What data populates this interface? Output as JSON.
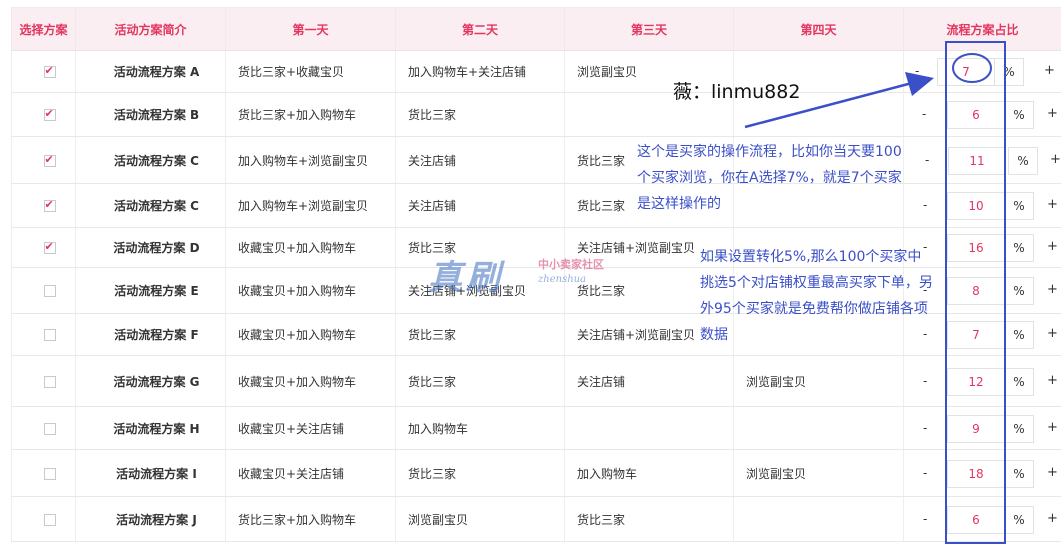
{
  "headers": [
    "选择方案",
    "活动方案简介",
    "第一天",
    "第二天",
    "第三天",
    "第四天",
    "流程方案占比"
  ],
  "rows": [
    {
      "checked": true,
      "name": "活动流程方案 A",
      "d1": "货比三家+收藏宝贝",
      "d2": "加入购物车+关注店铺",
      "d3": "浏览副宝贝",
      "d4": "",
      "value": "7"
    },
    {
      "checked": true,
      "name": "活动流程方案 B",
      "d1": "货比三家+加入购物车",
      "d2": "货比三家",
      "d3": "",
      "d4": "",
      "value": "6"
    },
    {
      "checked": true,
      "name": "活动流程方案 C",
      "d1": "加入购物车+浏览副宝贝",
      "d2": "关注店铺",
      "d3": "货比三家",
      "d4": "",
      "value": "11"
    },
    {
      "checked": true,
      "name": "活动流程方案 C",
      "d1": "加入购物车+浏览副宝贝",
      "d2": "关注店铺",
      "d3": "货比三家",
      "d4": "",
      "value": "10"
    },
    {
      "checked": true,
      "name": "活动流程方案 D",
      "d1": "收藏宝贝+加入购物车",
      "d2": "货比三家",
      "d3": "关注店铺+浏览副宝贝",
      "d4": "",
      "value": "16"
    },
    {
      "checked": false,
      "name": "活动流程方案 E",
      "d1": "收藏宝贝+加入购物车",
      "d2": "关注店铺+浏览副宝贝",
      "d3": "货比三家",
      "d4": "",
      "value": "8"
    },
    {
      "checked": false,
      "name": "活动流程方案 F",
      "d1": "收藏宝贝+加入购物车",
      "d2": "货比三家",
      "d3": "关注店铺+浏览副宝贝",
      "d4": "",
      "value": "7"
    },
    {
      "checked": false,
      "name": "活动流程方案 G",
      "d1": "收藏宝贝+加入购物车",
      "d2": "货比三家",
      "d3": "关注店铺",
      "d4": "浏览副宝贝",
      "value": "12"
    },
    {
      "checked": false,
      "name": "活动流程方案 H",
      "d1": "收藏宝贝+关注店铺",
      "d2": "加入购物车",
      "d3": "",
      "d4": "",
      "value": "9"
    },
    {
      "checked": false,
      "name": "活动流程方案 I",
      "d1": "收藏宝贝+关注店铺",
      "d2": "货比三家",
      "d3": "加入购物车",
      "d4": "浏览副宝贝",
      "value": "18"
    },
    {
      "checked": false,
      "name": "活动流程方案 J",
      "d1": "货比三家+加入购物车",
      "d2": "浏览副宝贝",
      "d3": "货比三家",
      "d4": "",
      "value": "6"
    }
  ],
  "stepper": {
    "minus": "-",
    "plus": "+",
    "unit": "%"
  },
  "annotations": {
    "wechat": "薇：linmu882",
    "note1": "这个是买家的操作流程，比如你当天要100个买家浏览，你在A选择7%，就是7个买家是这样操作的",
    "note2": "如果设置转化5%,那么100个买家中挑选5个对店铺权重最高买家下单，另外95个买家就是免费帮你做店铺各项数据"
  },
  "watermark": {
    "main": "真刷",
    "sub": "中小卖家社区",
    "domain": "zhenshua"
  },
  "colors": {
    "accent": "#e3355f",
    "header_bg": "#fbeef2",
    "annotation": "#3b4fc9"
  }
}
